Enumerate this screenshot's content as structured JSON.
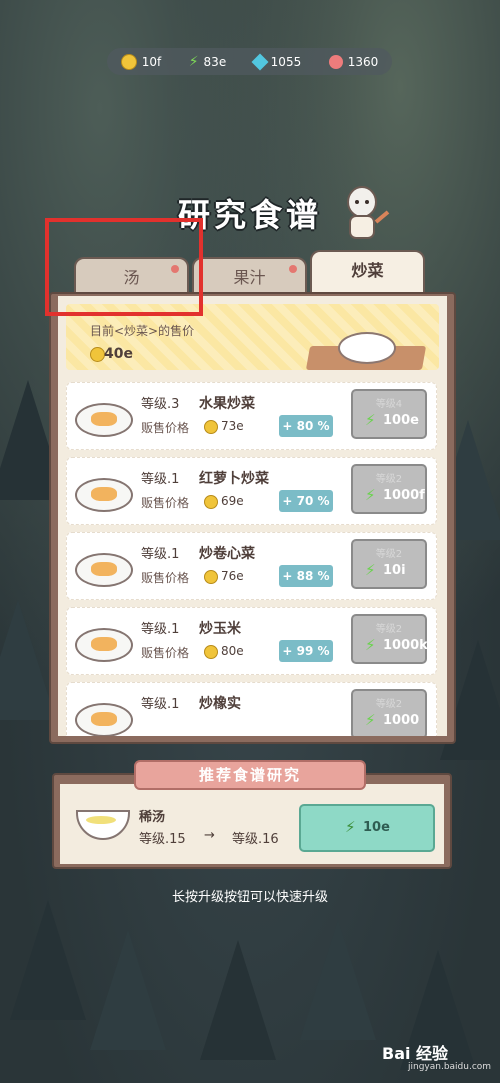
{
  "currencies": [
    {
      "icon": "coin-icon",
      "value": "10f"
    },
    {
      "icon": "lightning-icon",
      "value": "83e"
    },
    {
      "icon": "gem-icon",
      "value": "1055"
    },
    {
      "icon": "heart-icon",
      "value": "1360"
    }
  ],
  "title": "研究食谱",
  "tabs": [
    {
      "label": "汤",
      "active": false
    },
    {
      "label": "果汁",
      "active": false
    },
    {
      "label": "炒菜",
      "active": true
    }
  ],
  "price_banner": {
    "label": "目前<炒菜>的售价",
    "value": "40e"
  },
  "recipes": [
    {
      "level": "等级.3",
      "name": "水果炒菜",
      "price_label": "贩售价格",
      "price": "73e",
      "bonus": "+ 80 %",
      "req": "等级4",
      "cost": "100e"
    },
    {
      "level": "等级.1",
      "name": "红萝卜炒菜",
      "price_label": "贩售价格",
      "price": "69e",
      "bonus": "+ 70 %",
      "req": "等级2",
      "cost": "1000f"
    },
    {
      "level": "等级.1",
      "name": "炒卷心菜",
      "price_label": "贩售价格",
      "price": "76e",
      "bonus": "+ 88 %",
      "req": "等级2",
      "cost": "10i"
    },
    {
      "level": "等级.1",
      "name": "炒玉米",
      "price_label": "贩售价格",
      "price": "80e",
      "bonus": "+ 99 %",
      "req": "等级2",
      "cost": "1000k"
    },
    {
      "level": "等级.1",
      "name": "炒橡实",
      "price_label": "",
      "price": "",
      "bonus": "",
      "req": "等级2",
      "cost": "1000"
    }
  ],
  "recommend": {
    "title": "推荐食谱研究",
    "name": "稀汤",
    "level_from": "等级.15",
    "arrow": "→",
    "level_to": "等级.16",
    "cost": "10e"
  },
  "hint": "长按升级按钮可以快速升级",
  "watermark": {
    "main": "Bai 经验",
    "sub": "jingyan.baidu.com"
  },
  "colors": {
    "highlight": "#e2312d",
    "accent_green": "#8ed9c6",
    "bonus_blue": "#7bbcc7",
    "tab_dot": "#e47770"
  }
}
